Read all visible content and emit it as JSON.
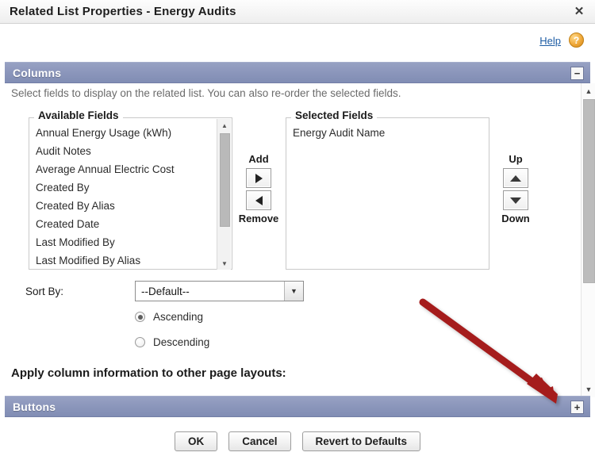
{
  "window": {
    "title": "Related List Properties - Energy Audits",
    "close_label": "✕"
  },
  "help": {
    "link_label": "Help",
    "icon_glyph": "?"
  },
  "sections": {
    "columns": {
      "title": "Columns",
      "toggle_glyph": "−",
      "description": "Select fields to display on the related list. You can also re-order the selected fields."
    },
    "buttons": {
      "title": "Buttons",
      "toggle_glyph": "+"
    }
  },
  "available_fields": {
    "legend": "Available Fields",
    "items": [
      "Annual Energy Usage (kWh)",
      "Audit Notes",
      "Average Annual Electric Cost",
      "Created By",
      "Created By Alias",
      "Created Date",
      "Last Modified By",
      "Last Modified By Alias"
    ]
  },
  "selected_fields": {
    "legend": "Selected Fields",
    "items": [
      "Energy Audit Name"
    ]
  },
  "movers": {
    "add_label": "Add",
    "remove_label": "Remove",
    "up_label": "Up",
    "down_label": "Down"
  },
  "sort": {
    "label": "Sort By:",
    "selected_value": "--Default--",
    "options": [
      "--Default--"
    ],
    "ascending_label": "Ascending",
    "descending_label": "Descending",
    "direction": "Ascending"
  },
  "apply_text": "Apply column information to other page layouts:",
  "footer": {
    "ok_label": "OK",
    "cancel_label": "Cancel",
    "revert_label": "Revert to Defaults"
  },
  "colors": {
    "section_header": "#8b96bb",
    "help_link": "#1d5ca4",
    "help_icon": "#f0a93a",
    "annotation_arrow": "#a51f1f"
  }
}
